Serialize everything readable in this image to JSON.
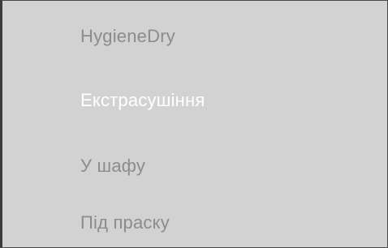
{
  "menu": {
    "items": [
      {
        "label": "HygieneDry",
        "selected": false
      },
      {
        "label": "Екстрасушіння",
        "selected": true
      },
      {
        "label": "У шафу",
        "selected": false
      },
      {
        "label": "Під праску",
        "selected": false
      }
    ]
  },
  "colors": {
    "background": "#d2d2d2",
    "item_text": "#8c8c8c",
    "selected_text": "#ffffff",
    "border": "#4a4a4a"
  }
}
